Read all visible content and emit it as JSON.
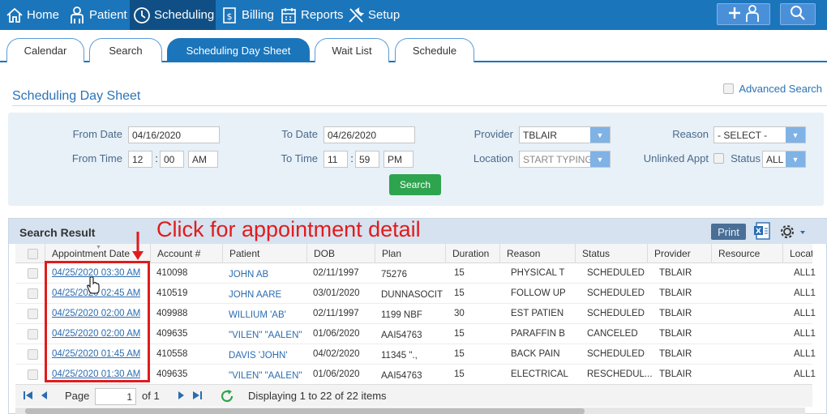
{
  "nav": {
    "items": [
      {
        "label": "Home",
        "icon": "home-icon"
      },
      {
        "label": "Patient",
        "icon": "person-icon"
      },
      {
        "label": "Scheduling",
        "icon": "clock-icon"
      },
      {
        "label": "Billing",
        "icon": "billing-icon"
      },
      {
        "label": "Reports",
        "icon": "calendar-icon"
      },
      {
        "label": "Setup",
        "icon": "tools-icon"
      }
    ],
    "active": "Scheduling",
    "right_buttons": [
      "add-patient-icon",
      "search-icon"
    ]
  },
  "tabs": [
    "Calendar",
    "Search",
    "Scheduling Day Sheet",
    "Wait List",
    "Schedule"
  ],
  "active_tab": "Scheduling Day Sheet",
  "page": {
    "title": "Scheduling Day Sheet",
    "advanced_search": "Advanced Search"
  },
  "filters": {
    "from_date_label": "From Date",
    "from_date": "04/16/2020",
    "to_date_label": "To Date",
    "to_date": "04/26/2020",
    "provider_label": "Provider",
    "provider": "TBLAIR",
    "reason_label": "Reason",
    "reason": "- SELECT -",
    "from_time_label": "From Time",
    "from_hour": "12",
    "from_min": "00",
    "from_ampm": "AM",
    "to_time_label": "To Time",
    "to_hour": "11",
    "to_min": "59",
    "to_ampm": "PM",
    "location_label": "Location",
    "location_placeholder": "START TYPING",
    "unlinked_label": "Unlinked Appt",
    "status_label": "Status",
    "status": "ALL",
    "search_button": "Search",
    "time_sep": ":"
  },
  "results": {
    "title": "Search Result",
    "print": "Print",
    "columns": [
      "Appointment Date",
      "Account #",
      "Patient",
      "DOB",
      "Plan",
      "Duration",
      "Reason",
      "Status",
      "Provider",
      "Resource",
      "Locati"
    ],
    "rows": [
      {
        "date": "04/25/2020 03:30 AM",
        "account": "410098",
        "patient": "JOHN AB",
        "dob": "02/11/1997",
        "plan": "75276",
        "duration": "15",
        "reason": "PHYSICAL T",
        "status": "SCHEDULED",
        "provider": "TBLAIR",
        "resource": "",
        "location": "ALL1"
      },
      {
        "date": "04/25/2020 02:45 AM",
        "account": "410519",
        "patient": "JOHN AARE",
        "dob": "03/01/2020",
        "plan": "DUNNASOCIT",
        "duration": "15",
        "reason": "FOLLOW UP",
        "status": "SCHEDULED",
        "provider": "TBLAIR",
        "resource": "",
        "location": "ALL1"
      },
      {
        "date": "04/25/2020 02:00 AM",
        "account": "409988",
        "patient": "WILLIUM 'AB'",
        "dob": "02/11/1997",
        "plan": "1199 NBF",
        "duration": "30",
        "reason": "EST PATIEN",
        "status": "SCHEDULED",
        "provider": "TBLAIR",
        "resource": "",
        "location": "ALL1"
      },
      {
        "date": "04/25/2020 02:00 AM",
        "account": "409635",
        "patient": "\"VILEN\" \"AALEN\"",
        "dob": "01/06/2020",
        "plan": "AAI54763",
        "duration": "15",
        "reason": "PARAFFIN B",
        "status": "CANCELED",
        "provider": "TBLAIR",
        "resource": "",
        "location": "ALL1"
      },
      {
        "date": "04/25/2020 01:45 AM",
        "account": "410558",
        "patient": "DAVIS 'JOHN'",
        "dob": "04/02/2020",
        "plan": "11345 \".,",
        "duration": "15",
        "reason": "BACK PAIN",
        "status": "SCHEDULED",
        "provider": "TBLAIR",
        "resource": "",
        "location": "ALL1"
      },
      {
        "date": "04/25/2020 01:30 AM",
        "account": "409635",
        "patient": "\"VILEN\" \"AALEN\"",
        "dob": "01/06/2020",
        "plan": "AAI54763",
        "duration": "15",
        "reason": "ELECTRICAL",
        "status": "RESCHEDUL...",
        "provider": "TBLAIR",
        "resource": "",
        "location": "ALL1"
      }
    ]
  },
  "pager": {
    "page_label": "Page",
    "page": "1",
    "of_label": "of 1",
    "display_text": "Displaying 1 to 22 of 22 items"
  },
  "annotation": {
    "text": "Click for appointment detail",
    "color": "#e21b1b"
  },
  "colors": {
    "brand": "#1b75bb",
    "nav_active": "#0f4f86",
    "success": "#2ea44f",
    "link": "#2b6cb0"
  }
}
